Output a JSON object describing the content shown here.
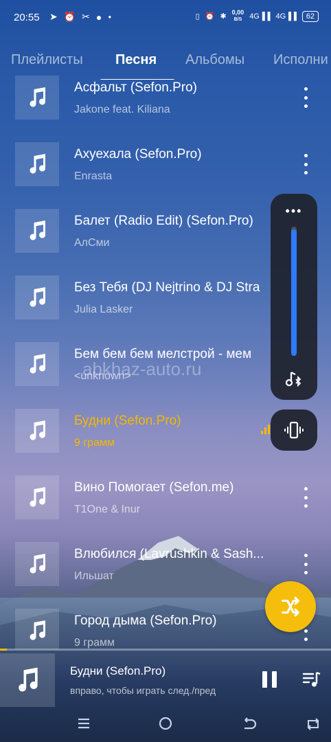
{
  "status": {
    "time": "20:55",
    "net_speed_top": "0,00",
    "net_speed_bottom": "B/S",
    "net1": "4G",
    "net2": "4G",
    "battery": "62"
  },
  "tabs": [
    {
      "label": "Плейлисты"
    },
    {
      "label": "Песня"
    },
    {
      "label": "Альбомы"
    },
    {
      "label": "Исполни"
    }
  ],
  "active_tab": "Песня",
  "songs": [
    {
      "title": "Асфальт (Sefon.Pro)",
      "artist": "Jakone feat. Kiliana"
    },
    {
      "title": "Ахуехала (Sefon.Pro)",
      "artist": "Enrasta"
    },
    {
      "title": "Балет (Radio Edit) (Sefon.Pro)",
      "artist": "АлСми"
    },
    {
      "title": "Без Тебя (DJ Nejtrino & DJ Stra",
      "artist": "Julia Lasker"
    },
    {
      "title": "Бем бем бем мелстрой - мем",
      "artist": "<unknown>"
    },
    {
      "title": "Будни (Sefon.Pro)",
      "artist": "9 грамм",
      "playing": true
    },
    {
      "title": "Вино Помогает (Sefon.me)",
      "artist": "T1One & Inur"
    },
    {
      "title": "Влюбился (Lavrushkin & Sash...",
      "artist": "Ильшат"
    },
    {
      "title": "Город дыма (Sefon.Pro)",
      "artist": "9 грамм"
    }
  ],
  "volume_panel": {
    "dots": "•••",
    "level": 0.98
  },
  "watermark": "abkhaz-auto.ru",
  "now_playing": {
    "title": "Будни (Sefon.Pro)",
    "hint": "вправо, чтобы играть след./пред",
    "progress": 0.02
  },
  "colors": {
    "accent": "#f5b800",
    "fab": "#f6be0c",
    "volume": "#2f7bff"
  }
}
